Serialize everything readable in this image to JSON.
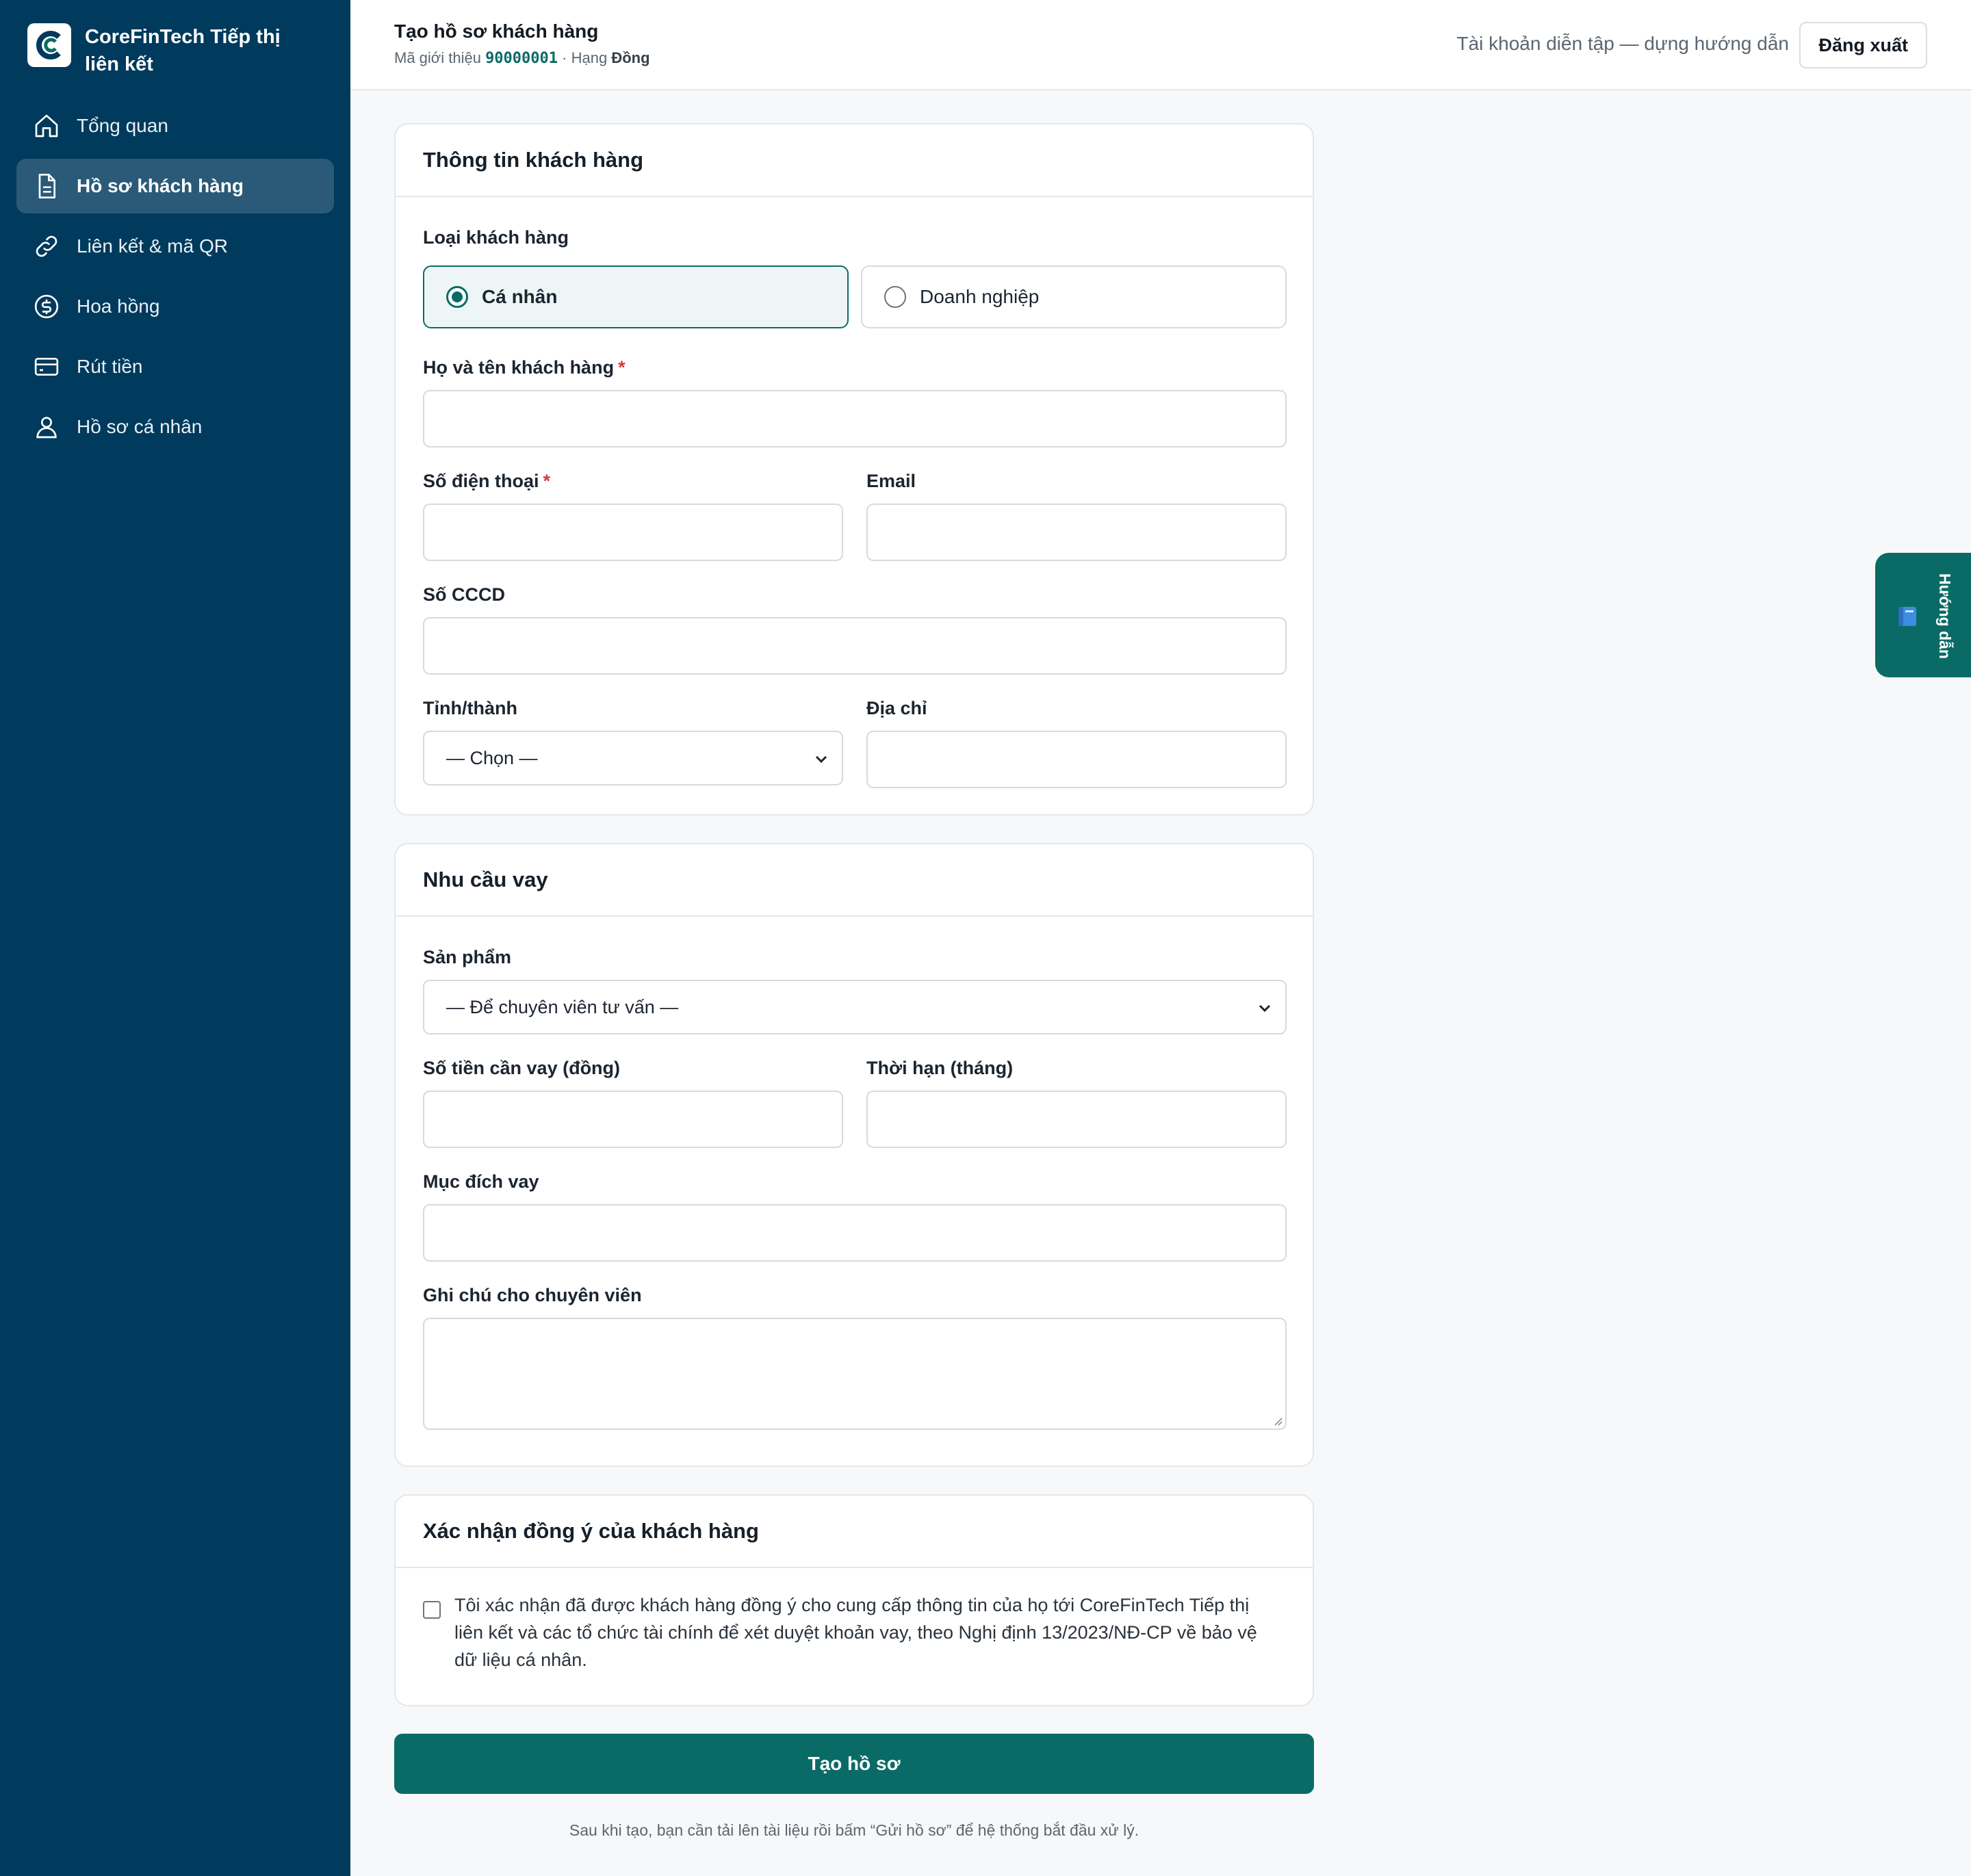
{
  "brand": {
    "name": "CoreFinTech Tiếp thị liên kết"
  },
  "nav": [
    {
      "label": "Tổng quan",
      "icon": "home-icon",
      "active": false
    },
    {
      "label": "Hồ sơ khách hàng",
      "icon": "document-icon",
      "active": true
    },
    {
      "label": "Liên kết & mã QR",
      "icon": "link-icon",
      "active": false
    },
    {
      "label": "Hoa hồng",
      "icon": "dollar-icon",
      "active": false
    },
    {
      "label": "Rút tiền",
      "icon": "card-icon",
      "active": false
    },
    {
      "label": "Hồ sơ cá nhân",
      "icon": "user-icon",
      "active": false
    }
  ],
  "topbar": {
    "title": "Tạo hồ sơ khách hàng",
    "sub_prefix": "Mã giới thiệu",
    "ref_code": "90000001",
    "sub_sep": " · Hạng",
    "rank": "Đồng",
    "demo_label": "Tài khoản diễn tập — dựng hướng dẫn",
    "logout": "Đăng xuất"
  },
  "customer_card": {
    "title": "Thông tin khách hàng",
    "type_label": "Loại khách hàng",
    "type_options": [
      "Cá nhân",
      "Doanh nghiệp"
    ],
    "type_selected": "Cá nhân",
    "fullname_label": "Họ và tên khách hàng",
    "phone_label": "Số điện thoại",
    "email_label": "Email",
    "cccd_label": "Số CCCD",
    "province_label": "Tỉnh/thành",
    "province_value": "— Chọn —",
    "address_label": "Địa chỉ",
    "required_mark": "*"
  },
  "loan_card": {
    "title": "Nhu cầu vay",
    "product_label": "Sản phẩm",
    "product_value": "— Để chuyên viên tư vấn —",
    "amount_label": "Số tiền cần vay (đồng)",
    "term_label": "Thời hạn (tháng)",
    "purpose_label": "Mục đích vay",
    "note_label": "Ghi chú cho chuyên viên"
  },
  "consent_card": {
    "title": "Xác nhận đồng ý của khách hàng",
    "text": "Tôi xác nhận đã được khách hàng đồng ý cho cung cấp thông tin của họ tới CoreFinTech Tiếp thị liên kết và các tổ chức tài chính để xét duyệt khoản vay, theo Nghị định 13/2023/NĐ-CP về bảo vệ dữ liệu cá nhân.",
    "checked": false
  },
  "submit": {
    "label": "Tạo hồ sơ"
  },
  "footnote": "Sau khi tạo, bạn cần tải lên tài liệu rồi bấm “Gửi hồ sơ” để hệ thống bắt đầu xử lý.",
  "guide": {
    "label": "Hướng dẫn",
    "icon": "book-icon"
  },
  "colors": {
    "sidebar": "#003a5c",
    "accent": "#0a6b66",
    "required": "#d33c3c"
  }
}
